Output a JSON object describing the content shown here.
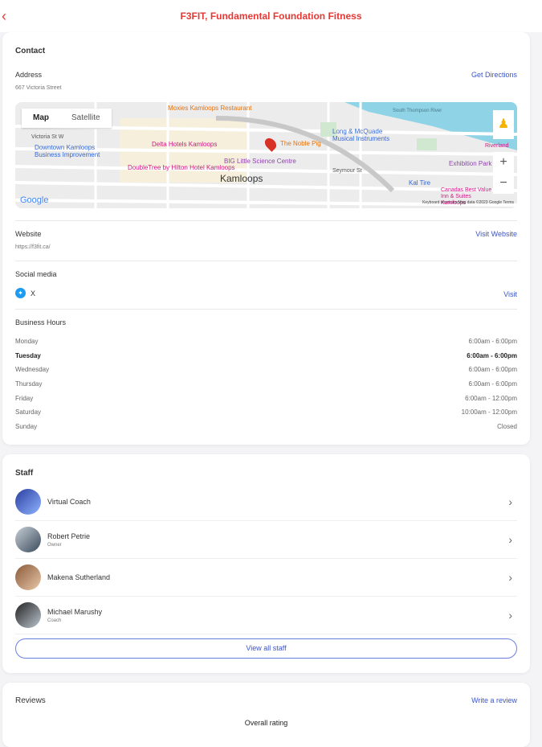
{
  "header": {
    "back": "‹",
    "title": "F3FIT, Fundamental Foundation Fitness"
  },
  "contact": {
    "heading": "Contact",
    "address_label": "Address",
    "address": "667 Victoria Street",
    "directions": "Get Directions",
    "map": {
      "tab_map": "Map",
      "tab_satellite": "Satellite",
      "city": "Kamloops",
      "google": "Google",
      "attribution": "Keyboard shortcuts   Map data ©2023 Google   Terms",
      "labels": [
        "Moxies Kamloops Restaurant",
        "Delta Hotels Kamloops",
        "The Noble Pig",
        "BIG Little Science Centre",
        "DoubleTree by Hilton Hotel Kamloops",
        "Downtown Kamloops Business Improvement",
        "Long & McQuade Musical Instruments",
        "Exhibition Park",
        "Kal Tire",
        "Seymour St",
        "Victoria St W",
        "South Thompson River",
        "Canadas Best Value Inn & Suites Kamloops",
        "Riverland"
      ]
    },
    "website_label": "Website",
    "website": "https://f3fit.ca/",
    "visit_website": "Visit Website",
    "social_label": "Social media",
    "social_name": "X",
    "social_visit": "Visit",
    "hours_label": "Business Hours",
    "hours": [
      {
        "day": "Monday",
        "time": "6:00am - 6:00pm"
      },
      {
        "day": "Tuesday",
        "time": "6:00am - 6:00pm",
        "today": true
      },
      {
        "day": "Wednesday",
        "time": "6:00am - 6:00pm"
      },
      {
        "day": "Thursday",
        "time": "6:00am - 6:00pm"
      },
      {
        "day": "Friday",
        "time": "6:00am - 12:00pm"
      },
      {
        "day": "Saturday",
        "time": "10:00am - 12:00pm"
      },
      {
        "day": "Sunday",
        "time": "Closed"
      }
    ]
  },
  "staff": {
    "heading": "Staff",
    "members": [
      {
        "name": "Virtual Coach",
        "role": ""
      },
      {
        "name": "Robert Petrie",
        "role": "Owner"
      },
      {
        "name": "Makena Sutherland",
        "role": ""
      },
      {
        "name": "Michael Marushy",
        "role": "Coach"
      }
    ],
    "view_all": "View all staff"
  },
  "reviews": {
    "heading": "Reviews",
    "write": "Write a review",
    "overall": "Overall rating"
  }
}
